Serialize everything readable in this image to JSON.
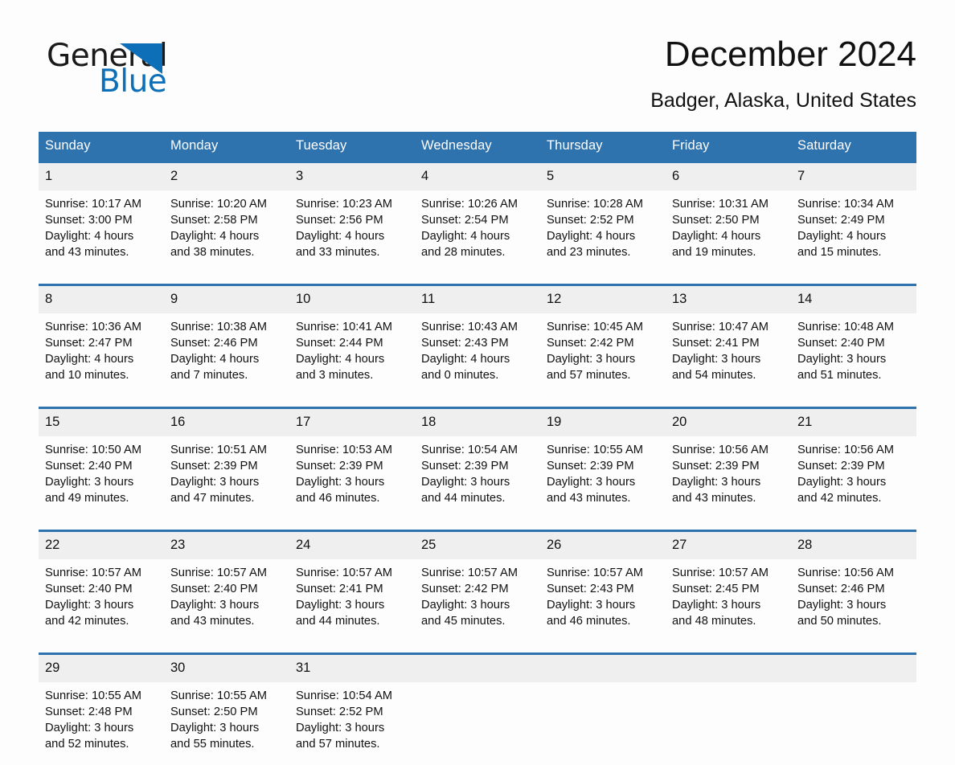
{
  "brand": {
    "name_part1": "General",
    "name_part2": "Blue",
    "triangle_color": "#0d6fb8",
    "icon": "triangle-logo-icon"
  },
  "header": {
    "title": "December 2024",
    "subtitle": "Badger, Alaska, United States",
    "accent_color": "#2E72AE",
    "daynum_band_color": "#efefef"
  },
  "calendar": {
    "weekday_headers": [
      "Sunday",
      "Monday",
      "Tuesday",
      "Wednesday",
      "Thursday",
      "Friday",
      "Saturday"
    ],
    "weeks": [
      {
        "days": [
          {
            "num": "1",
            "sunrise": "Sunrise: 10:17 AM",
            "sunset": "Sunset: 3:00 PM",
            "daylight_line1": "Daylight: 4 hours",
            "daylight_line2": "and 43 minutes."
          },
          {
            "num": "2",
            "sunrise": "Sunrise: 10:20 AM",
            "sunset": "Sunset: 2:58 PM",
            "daylight_line1": "Daylight: 4 hours",
            "daylight_line2": "and 38 minutes."
          },
          {
            "num": "3",
            "sunrise": "Sunrise: 10:23 AM",
            "sunset": "Sunset: 2:56 PM",
            "daylight_line1": "Daylight: 4 hours",
            "daylight_line2": "and 33 minutes."
          },
          {
            "num": "4",
            "sunrise": "Sunrise: 10:26 AM",
            "sunset": "Sunset: 2:54 PM",
            "daylight_line1": "Daylight: 4 hours",
            "daylight_line2": "and 28 minutes."
          },
          {
            "num": "5",
            "sunrise": "Sunrise: 10:28 AM",
            "sunset": "Sunset: 2:52 PM",
            "daylight_line1": "Daylight: 4 hours",
            "daylight_line2": "and 23 minutes."
          },
          {
            "num": "6",
            "sunrise": "Sunrise: 10:31 AM",
            "sunset": "Sunset: 2:50 PM",
            "daylight_line1": "Daylight: 4 hours",
            "daylight_line2": "and 19 minutes."
          },
          {
            "num": "7",
            "sunrise": "Sunrise: 10:34 AM",
            "sunset": "Sunset: 2:49 PM",
            "daylight_line1": "Daylight: 4 hours",
            "daylight_line2": "and 15 minutes."
          }
        ]
      },
      {
        "days": [
          {
            "num": "8",
            "sunrise": "Sunrise: 10:36 AM",
            "sunset": "Sunset: 2:47 PM",
            "daylight_line1": "Daylight: 4 hours",
            "daylight_line2": "and 10 minutes."
          },
          {
            "num": "9",
            "sunrise": "Sunrise: 10:38 AM",
            "sunset": "Sunset: 2:46 PM",
            "daylight_line1": "Daylight: 4 hours",
            "daylight_line2": "and 7 minutes."
          },
          {
            "num": "10",
            "sunrise": "Sunrise: 10:41 AM",
            "sunset": "Sunset: 2:44 PM",
            "daylight_line1": "Daylight: 4 hours",
            "daylight_line2": "and 3 minutes."
          },
          {
            "num": "11",
            "sunrise": "Sunrise: 10:43 AM",
            "sunset": "Sunset: 2:43 PM",
            "daylight_line1": "Daylight: 4 hours",
            "daylight_line2": "and 0 minutes."
          },
          {
            "num": "12",
            "sunrise": "Sunrise: 10:45 AM",
            "sunset": "Sunset: 2:42 PM",
            "daylight_line1": "Daylight: 3 hours",
            "daylight_line2": "and 57 minutes."
          },
          {
            "num": "13",
            "sunrise": "Sunrise: 10:47 AM",
            "sunset": "Sunset: 2:41 PM",
            "daylight_line1": "Daylight: 3 hours",
            "daylight_line2": "and 54 minutes."
          },
          {
            "num": "14",
            "sunrise": "Sunrise: 10:48 AM",
            "sunset": "Sunset: 2:40 PM",
            "daylight_line1": "Daylight: 3 hours",
            "daylight_line2": "and 51 minutes."
          }
        ]
      },
      {
        "days": [
          {
            "num": "15",
            "sunrise": "Sunrise: 10:50 AM",
            "sunset": "Sunset: 2:40 PM",
            "daylight_line1": "Daylight: 3 hours",
            "daylight_line2": "and 49 minutes."
          },
          {
            "num": "16",
            "sunrise": "Sunrise: 10:51 AM",
            "sunset": "Sunset: 2:39 PM",
            "daylight_line1": "Daylight: 3 hours",
            "daylight_line2": "and 47 minutes."
          },
          {
            "num": "17",
            "sunrise": "Sunrise: 10:53 AM",
            "sunset": "Sunset: 2:39 PM",
            "daylight_line1": "Daylight: 3 hours",
            "daylight_line2": "and 46 minutes."
          },
          {
            "num": "18",
            "sunrise": "Sunrise: 10:54 AM",
            "sunset": "Sunset: 2:39 PM",
            "daylight_line1": "Daylight: 3 hours",
            "daylight_line2": "and 44 minutes."
          },
          {
            "num": "19",
            "sunrise": "Sunrise: 10:55 AM",
            "sunset": "Sunset: 2:39 PM",
            "daylight_line1": "Daylight: 3 hours",
            "daylight_line2": "and 43 minutes."
          },
          {
            "num": "20",
            "sunrise": "Sunrise: 10:56 AM",
            "sunset": "Sunset: 2:39 PM",
            "daylight_line1": "Daylight: 3 hours",
            "daylight_line2": "and 43 minutes."
          },
          {
            "num": "21",
            "sunrise": "Sunrise: 10:56 AM",
            "sunset": "Sunset: 2:39 PM",
            "daylight_line1": "Daylight: 3 hours",
            "daylight_line2": "and 42 minutes."
          }
        ]
      },
      {
        "days": [
          {
            "num": "22",
            "sunrise": "Sunrise: 10:57 AM",
            "sunset": "Sunset: 2:40 PM",
            "daylight_line1": "Daylight: 3 hours",
            "daylight_line2": "and 42 minutes."
          },
          {
            "num": "23",
            "sunrise": "Sunrise: 10:57 AM",
            "sunset": "Sunset: 2:40 PM",
            "daylight_line1": "Daylight: 3 hours",
            "daylight_line2": "and 43 minutes."
          },
          {
            "num": "24",
            "sunrise": "Sunrise: 10:57 AM",
            "sunset": "Sunset: 2:41 PM",
            "daylight_line1": "Daylight: 3 hours",
            "daylight_line2": "and 44 minutes."
          },
          {
            "num": "25",
            "sunrise": "Sunrise: 10:57 AM",
            "sunset": "Sunset: 2:42 PM",
            "daylight_line1": "Daylight: 3 hours",
            "daylight_line2": "and 45 minutes."
          },
          {
            "num": "26",
            "sunrise": "Sunrise: 10:57 AM",
            "sunset": "Sunset: 2:43 PM",
            "daylight_line1": "Daylight: 3 hours",
            "daylight_line2": "and 46 minutes."
          },
          {
            "num": "27",
            "sunrise": "Sunrise: 10:57 AM",
            "sunset": "Sunset: 2:45 PM",
            "daylight_line1": "Daylight: 3 hours",
            "daylight_line2": "and 48 minutes."
          },
          {
            "num": "28",
            "sunrise": "Sunrise: 10:56 AM",
            "sunset": "Sunset: 2:46 PM",
            "daylight_line1": "Daylight: 3 hours",
            "daylight_line2": "and 50 minutes."
          }
        ]
      },
      {
        "days": [
          {
            "num": "29",
            "sunrise": "Sunrise: 10:55 AM",
            "sunset": "Sunset: 2:48 PM",
            "daylight_line1": "Daylight: 3 hours",
            "daylight_line2": "and 52 minutes."
          },
          {
            "num": "30",
            "sunrise": "Sunrise: 10:55 AM",
            "sunset": "Sunset: 2:50 PM",
            "daylight_line1": "Daylight: 3 hours",
            "daylight_line2": "and 55 minutes."
          },
          {
            "num": "31",
            "sunrise": "Sunrise: 10:54 AM",
            "sunset": "Sunset: 2:52 PM",
            "daylight_line1": "Daylight: 3 hours",
            "daylight_line2": "and 57 minutes."
          },
          {
            "num": "",
            "sunrise": "",
            "sunset": "",
            "daylight_line1": "",
            "daylight_line2": ""
          },
          {
            "num": "",
            "sunrise": "",
            "sunset": "",
            "daylight_line1": "",
            "daylight_line2": ""
          },
          {
            "num": "",
            "sunrise": "",
            "sunset": "",
            "daylight_line1": "",
            "daylight_line2": ""
          },
          {
            "num": "",
            "sunrise": "",
            "sunset": "",
            "daylight_line1": "",
            "daylight_line2": ""
          }
        ]
      }
    ]
  }
}
